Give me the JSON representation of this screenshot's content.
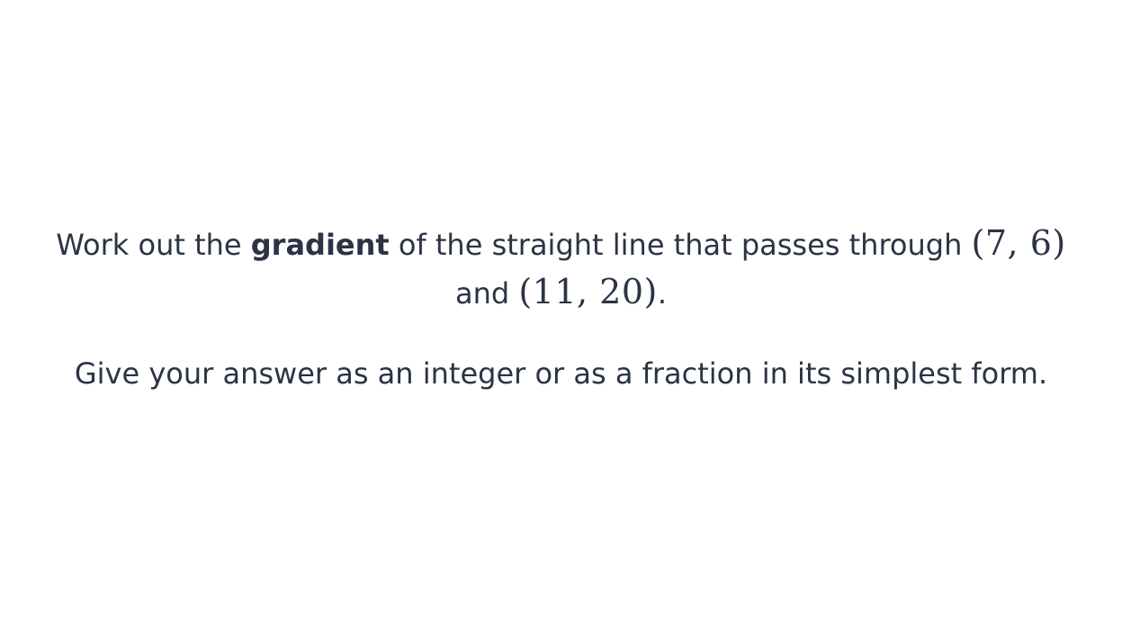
{
  "question": {
    "line1": {
      "prefix": "Work out the ",
      "keyword": "gradient",
      "middle": " of the straight line that passes through ",
      "point1": "(7, 6)"
    },
    "line2": {
      "prefix": "and ",
      "point2": "(11, 20)",
      "suffix": "."
    },
    "instruction": "Give your answer as an integer or as a fraction in its simplest form."
  }
}
